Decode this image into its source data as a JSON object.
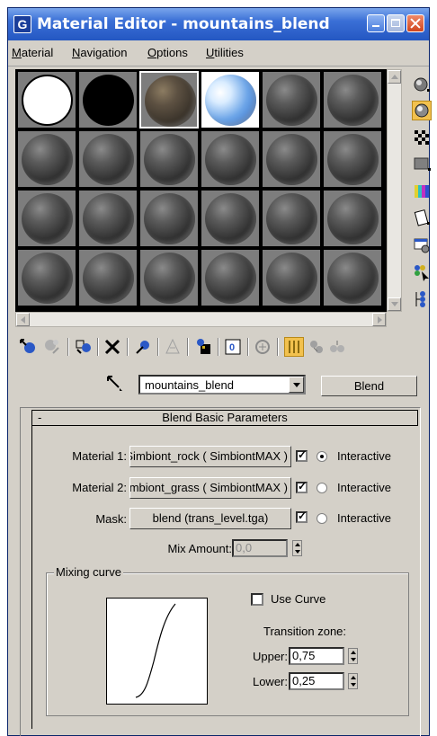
{
  "window": {
    "title": "Material Editor - mountains_blend",
    "app_icon_glyph": "G"
  },
  "menu": [
    {
      "label": "Material",
      "accel": "M",
      "rest": "aterial"
    },
    {
      "label": "Navigation",
      "accel": "N",
      "rest": "avigation"
    },
    {
      "label": "Options",
      "accel": "O",
      "rest": "ptions"
    },
    {
      "label": "Utilities",
      "accel": "U",
      "rest": "tilities"
    }
  ],
  "sample_slots": {
    "rows": 4,
    "cols": 6,
    "active_index": 2,
    "types": [
      "white",
      "black",
      "rock",
      "sky",
      "default",
      "default",
      "default",
      "default",
      "default",
      "default",
      "default",
      "default",
      "default",
      "default",
      "default",
      "default",
      "default",
      "default",
      "default",
      "default",
      "default",
      "default",
      "default",
      "default"
    ]
  },
  "side_tools": [
    "sample-type-icon",
    "backlight-icon",
    "background-icon",
    "uv-tiling-icon",
    "video-color-check-icon",
    "make-preview-icon",
    "options-icon",
    "select-by-material-icon",
    "material-navigator-icon"
  ],
  "bottom_tools": [
    "get-material-icon",
    "put-to-scene-icon",
    "assign-to-selection-icon",
    "reset-map-icon",
    "make-copy-icon",
    "make-unique-icon",
    "put-to-library-icon",
    "material-effects-channel-icon",
    "show-map-in-viewport-icon",
    "show-end-result-icon",
    "go-to-parent-icon",
    "go-forward-to-sibling-icon"
  ],
  "name_row": {
    "material_name": "mountains_blend",
    "type_button": "Blend"
  },
  "rollout": {
    "collapse_symbol": "-",
    "title": "Blend Basic Parameters",
    "material1": {
      "label": "Material 1:",
      "value": "Rock_Simbiont_rock  ( SimbiontMAX )",
      "checked": true,
      "radio_selected": true,
      "radio_label": "Interactive"
    },
    "material2": {
      "label": "Material 2:",
      "value": "Simbiont_grass  ( SimbiontMAX )",
      "checked": true,
      "radio_selected": false,
      "radio_label": "Interactive"
    },
    "mask": {
      "label": "Mask:",
      "value": "blend (trans_level.tga)",
      "checked": true,
      "radio_selected": false,
      "radio_label": "Interactive"
    },
    "mix_amount": {
      "label": "Mix Amount:",
      "value": "0,0"
    }
  },
  "mixing_curve": {
    "group_label": "Mixing curve",
    "use_curve_label": "Use Curve",
    "use_curve_checked": false,
    "transition_label": "Transition zone:",
    "upper_label": "Upper:",
    "upper_value": "0,75",
    "lower_label": "Lower:",
    "lower_value": "0,25"
  }
}
